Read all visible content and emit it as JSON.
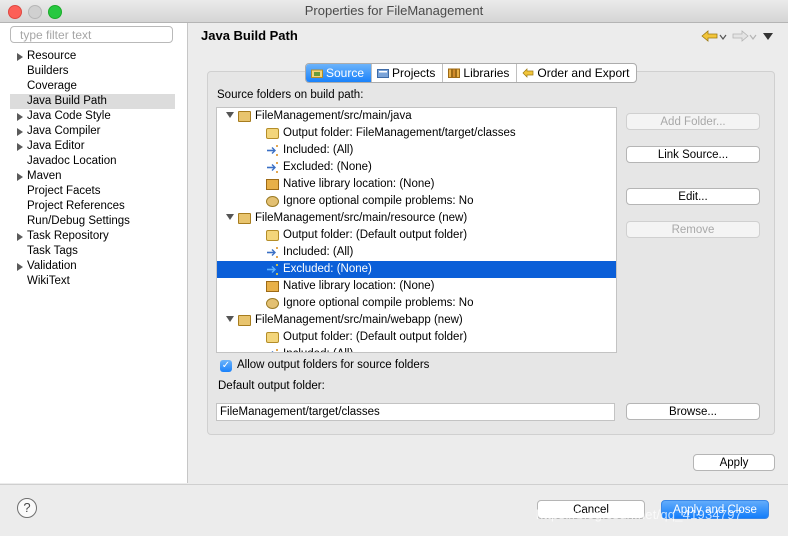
{
  "window": {
    "title": "Properties for FileManagement"
  },
  "filter": {
    "placeholder": "type filter text"
  },
  "nav": {
    "items": [
      {
        "label": "Resource",
        "expandable": true,
        "selected": false
      },
      {
        "label": "Builders",
        "expandable": false,
        "selected": false
      },
      {
        "label": "Coverage",
        "expandable": false,
        "selected": false
      },
      {
        "label": "Java Build Path",
        "expandable": false,
        "selected": true
      },
      {
        "label": "Java Code Style",
        "expandable": true,
        "selected": false
      },
      {
        "label": "Java Compiler",
        "expandable": true,
        "selected": false
      },
      {
        "label": "Java Editor",
        "expandable": true,
        "selected": false
      },
      {
        "label": "Javadoc Location",
        "expandable": false,
        "selected": false
      },
      {
        "label": "Maven",
        "expandable": true,
        "selected": false
      },
      {
        "label": "Project Facets",
        "expandable": false,
        "selected": false
      },
      {
        "label": "Project References",
        "expandable": false,
        "selected": false
      },
      {
        "label": "Run/Debug Settings",
        "expandable": false,
        "selected": false
      },
      {
        "label": "Task Repository",
        "expandable": true,
        "selected": false
      },
      {
        "label": "Task Tags",
        "expandable": false,
        "selected": false
      },
      {
        "label": "Validation",
        "expandable": true,
        "selected": false
      },
      {
        "label": "WikiText",
        "expandable": false,
        "selected": false
      }
    ]
  },
  "page": {
    "title": "Java Build Path",
    "back_icon": "arrow-left-icon",
    "forward_icon": "arrow-right-icon",
    "menu_icon": "chevron-down-icon"
  },
  "tabs": [
    {
      "label": "Source",
      "icon": "source-folder-icon",
      "active": true
    },
    {
      "label": "Projects",
      "icon": "projects-icon",
      "active": false
    },
    {
      "label": "Libraries",
      "icon": "libraries-icon",
      "active": false
    },
    {
      "label": "Order and Export",
      "icon": "order-export-icon",
      "active": false
    }
  ],
  "source": {
    "label": "Source folders on build path:",
    "tree": [
      {
        "level": 0,
        "text": "FileManagement/src/main/java",
        "icon": "package-folder-icon",
        "expanded": true
      },
      {
        "level": 1,
        "text": "Output folder: FileManagement/target/classes",
        "icon": "output-folder-icon"
      },
      {
        "level": 1,
        "text": "Included: (All)",
        "icon": "inclusion-filter-icon"
      },
      {
        "level": 1,
        "text": "Excluded: (None)",
        "icon": "exclusion-filter-icon"
      },
      {
        "level": 1,
        "text": "Native library location: (None)",
        "icon": "native-library-icon"
      },
      {
        "level": 1,
        "text": "Ignore optional compile problems: No",
        "icon": "ignore-problems-icon"
      },
      {
        "level": 0,
        "text": "FileManagement/src/main/resource (new)",
        "icon": "package-folder-icon",
        "expanded": true
      },
      {
        "level": 1,
        "text": "Output folder: (Default output folder)",
        "icon": "output-folder-icon"
      },
      {
        "level": 1,
        "text": "Included: (All)",
        "icon": "inclusion-filter-icon"
      },
      {
        "level": 1,
        "text": "Excluded: (None)",
        "icon": "exclusion-filter-icon",
        "selected": true
      },
      {
        "level": 1,
        "text": "Native library location: (None)",
        "icon": "native-library-icon"
      },
      {
        "level": 1,
        "text": "Ignore optional compile problems: No",
        "icon": "ignore-problems-icon"
      },
      {
        "level": 0,
        "text": "FileManagement/src/main/webapp (new)",
        "icon": "package-folder-icon",
        "expanded": true
      },
      {
        "level": 1,
        "text": "Output folder: (Default output folder)",
        "icon": "output-folder-icon"
      },
      {
        "level": 1,
        "text": "Included: (All)",
        "icon": "inclusion-filter-icon"
      }
    ],
    "buttons": {
      "add_folder": "Add Folder...",
      "link_source": "Link Source...",
      "edit": "Edit...",
      "remove": "Remove"
    },
    "allow_output_label": "Allow output folders for source folders",
    "allow_output_checked": true,
    "default_output_label": "Default output folder:",
    "default_output_value": "FileManagement/target/classes",
    "browse": "Browse..."
  },
  "footer": {
    "apply": "Apply",
    "cancel": "Cancel",
    "apply_close": "Apply and Close",
    "help_glyph": "?",
    "watermark": "https://blog.csdn.net/qq_41934797"
  },
  "colors": {
    "accent": "#1a82fb",
    "selection": "#0b5fd8"
  }
}
